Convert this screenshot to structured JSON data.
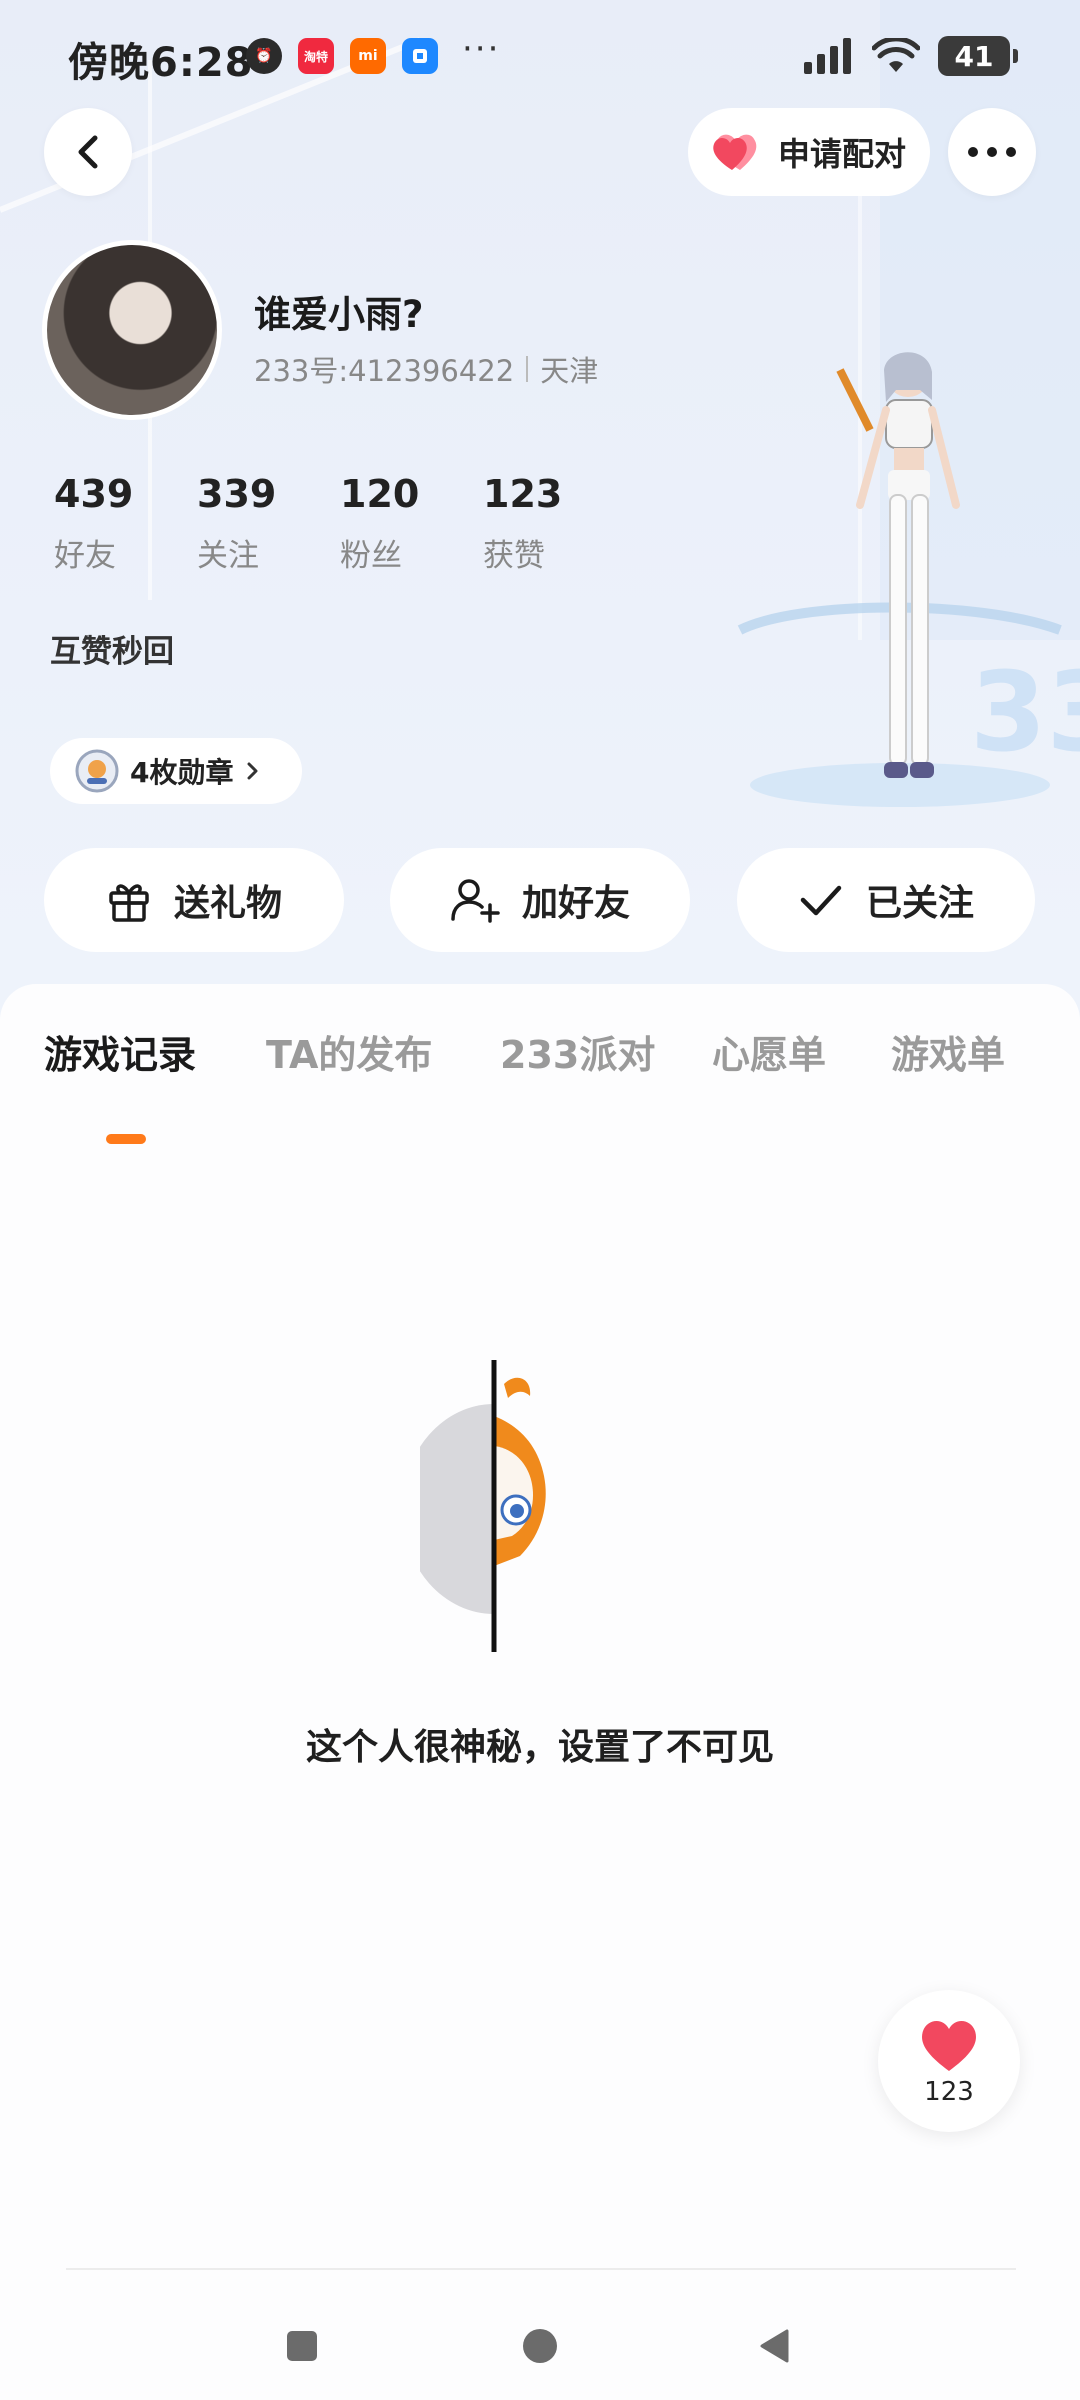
{
  "status_bar": {
    "time": "傍晚6:28",
    "app_icons": [
      {
        "name": "taote-icon",
        "label": "淘特",
        "color": "#f0293f"
      },
      {
        "name": "mi-icon",
        "label": "mi",
        "color": "#ff6a00"
      },
      {
        "name": "app-cube-icon",
        "label": "",
        "color": "#1e88ff"
      }
    ],
    "more_dots": "···",
    "battery": "41"
  },
  "header": {
    "pair_label": "申请配对"
  },
  "profile": {
    "nickname": "谁爱小雨?",
    "uid": "233号:412396422",
    "location": "天津",
    "stats": [
      {
        "value": "439",
        "label": "好友"
      },
      {
        "value": "339",
        "label": "关注"
      },
      {
        "value": "120",
        "label": "粉丝"
      },
      {
        "value": "123",
        "label": "获赞"
      }
    ],
    "signature": "互赞秒回",
    "medals": "4枚勋章"
  },
  "actions": {
    "gift": "送礼物",
    "add_friend": "加好友",
    "followed": "已关注"
  },
  "tabs": [
    "游戏记录",
    "TA的发布",
    "233派对",
    "心愿单",
    "游戏单"
  ],
  "active_tab": 0,
  "empty_state": {
    "message": "这个人很神秘，设置了不可见"
  },
  "like_float": {
    "count": "123"
  },
  "colors": {
    "accent": "#ff7a1a",
    "heart": "#f2485f",
    "background": "#eef3fb"
  }
}
